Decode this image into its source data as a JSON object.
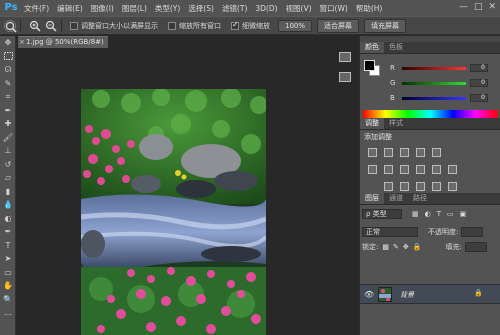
{
  "app": {
    "logo": "Ps"
  },
  "menu": [
    "文件(F)",
    "编辑(E)",
    "图像(I)",
    "图层(L)",
    "类型(Y)",
    "选择(S)",
    "滤镜(T)",
    "3D(D)",
    "视图(V)",
    "窗口(W)",
    "帮助(H)"
  ],
  "window_controls": {
    "minimize": "—",
    "maximize": "□",
    "close": "✕"
  },
  "options": {
    "resize_windows_label": "调整窗口大小以满屏显示",
    "resize_windows_checked": false,
    "zoom_all_label": "缩放所有窗口",
    "zoom_all_checked": false,
    "scrubby_zoom_label": "细微缩放",
    "scrubby_zoom_checked": true,
    "btn_100": "100%",
    "btn_fit": "适合屏幕",
    "btn_fill": "填充屏幕"
  },
  "document": {
    "tab_title": "1.jpg @ 50%(RGB/8#)",
    "close": "×"
  },
  "color_panel": {
    "tabs": [
      "颜色",
      "色板"
    ],
    "r_label": "R",
    "r_value": "0",
    "g_label": "G",
    "g_value": "0",
    "b_label": "B",
    "b_value": "0",
    "colors": {
      "red": "#e03030",
      "green": "#30c030",
      "blue": "#3050e0"
    }
  },
  "adjustments_panel": {
    "tabs": [
      "调整",
      "样式"
    ],
    "title": "添加调整"
  },
  "layers_panel": {
    "tabs": [
      "图层",
      "通道",
      "路径"
    ],
    "filter_kind": "ρ 类型",
    "blend_mode": "正常",
    "opacity_label": "不透明度:",
    "opacity_value": "",
    "lock_label": "锁定:",
    "fill_label": "填充:",
    "layers": [
      {
        "name": "背景",
        "visible": true,
        "locked": true
      }
    ]
  }
}
